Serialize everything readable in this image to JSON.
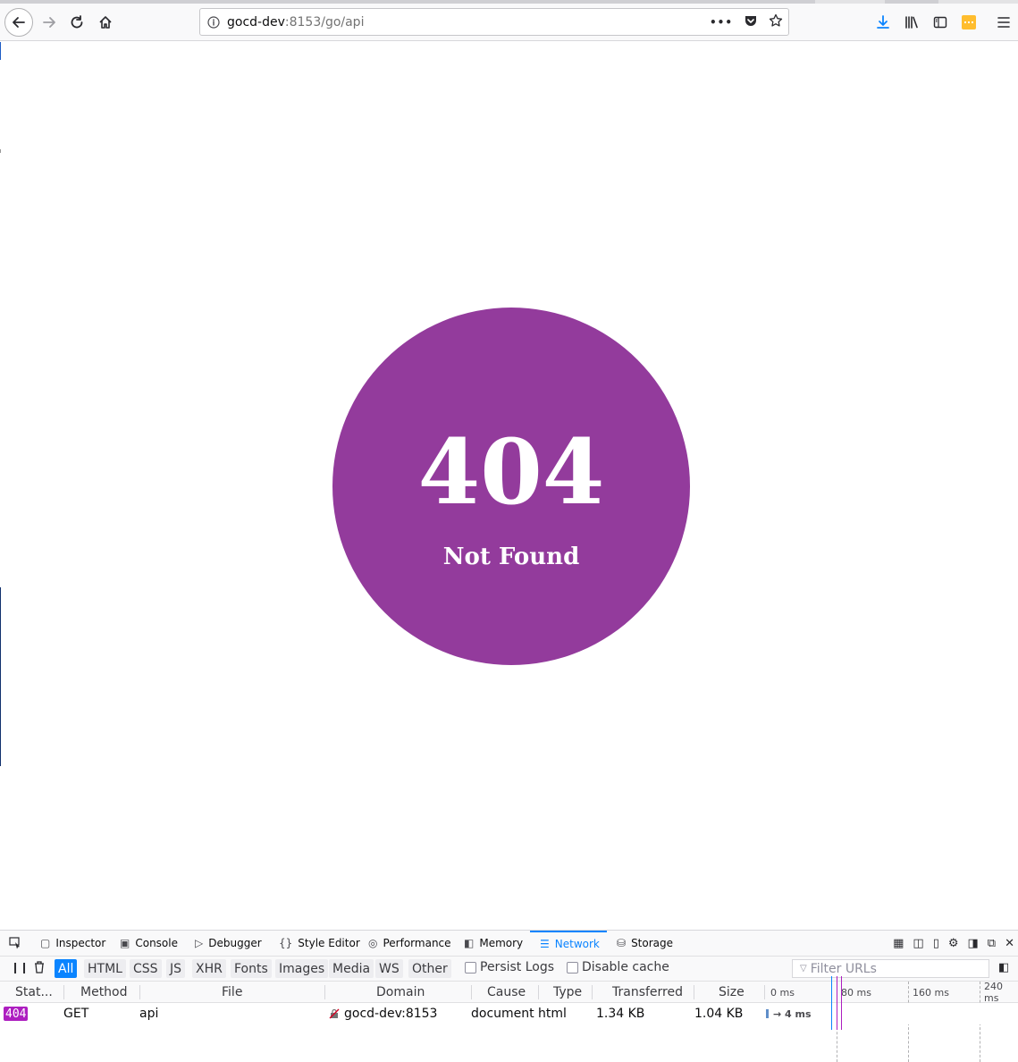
{
  "browser": {
    "url_host": "gocd-dev",
    "url_rest": ":8153/go/api",
    "page_actions_label": "•••"
  },
  "page": {
    "error_code": "404",
    "error_message": "Not Found",
    "circle_color": "#933b9c"
  },
  "devtools": {
    "tabs": [
      {
        "label": "Inspector",
        "icon": "inspector-icon"
      },
      {
        "label": "Console",
        "icon": "console-icon"
      },
      {
        "label": "Debugger",
        "icon": "debugger-icon"
      },
      {
        "label": "Style Editor",
        "icon": "style-editor-icon"
      },
      {
        "label": "Performance",
        "icon": "performance-icon"
      },
      {
        "label": "Memory",
        "icon": "memory-icon"
      },
      {
        "label": "Network",
        "icon": "network-icon"
      },
      {
        "label": "Storage",
        "icon": "storage-icon"
      }
    ],
    "active_tab": "Network",
    "filters": [
      "All",
      "HTML",
      "CSS",
      "JS",
      "XHR",
      "Fonts",
      "Images",
      "Media",
      "WS",
      "Other"
    ],
    "active_filter": "All",
    "persist_logs_label": "Persist Logs",
    "disable_cache_label": "Disable cache",
    "filter_placeholder": "Filter URLs",
    "columns": [
      "Stat...",
      "Method",
      "File",
      "Domain",
      "Cause",
      "Type",
      "Transferred",
      "Size"
    ],
    "timeline_ticks": [
      "0 ms",
      "80 ms",
      "160 ms",
      "240 ms"
    ],
    "requests": [
      {
        "status": "404",
        "method": "GET",
        "file": "api",
        "domain": "gocd-dev:8153",
        "cause": "document",
        "type": "html",
        "transferred": "1.34 KB",
        "size": "1.04 KB",
        "timing": "→ 4 ms"
      }
    ],
    "accent_color": "#0a84ff",
    "status_color": "#ad1ec0"
  }
}
